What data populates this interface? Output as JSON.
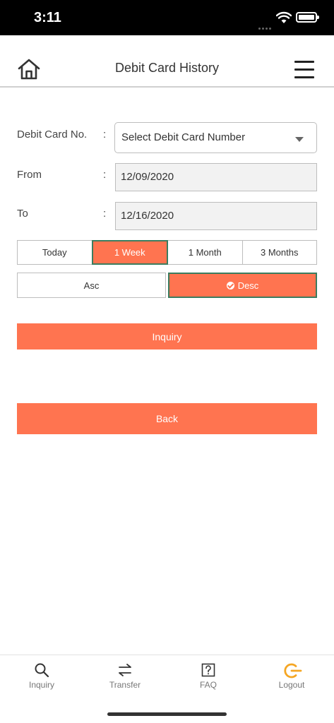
{
  "status_bar": {
    "time": "3:11"
  },
  "header": {
    "title": "Debit Card History"
  },
  "form": {
    "card_label": "Debit Card No.",
    "card_select_value": "Select Debit Card Number",
    "from_label": "From",
    "from_value": "12/09/2020",
    "to_label": "To",
    "to_value": "12/16/2020",
    "colon": ":"
  },
  "period_buttons": [
    "Today",
    "1 Week",
    "1 Month",
    "3 Months"
  ],
  "period_selected": "1 Week",
  "order_buttons": {
    "asc": "Asc",
    "desc": "Desc",
    "selected": "Desc"
  },
  "actions": {
    "inquiry": "Inquiry",
    "back": "Back"
  },
  "tab_bar": {
    "items": [
      {
        "label": "Inquiry",
        "icon": "search-icon"
      },
      {
        "label": "Transfer",
        "icon": "transfer-arrows-icon"
      },
      {
        "label": "FAQ",
        "icon": "question-box-icon"
      },
      {
        "label": "Logout",
        "icon": "logout-icon"
      }
    ]
  },
  "colors": {
    "accent": "#ff7450",
    "active_border": "#3b7c5f",
    "logout_icon": "#f5a623"
  }
}
